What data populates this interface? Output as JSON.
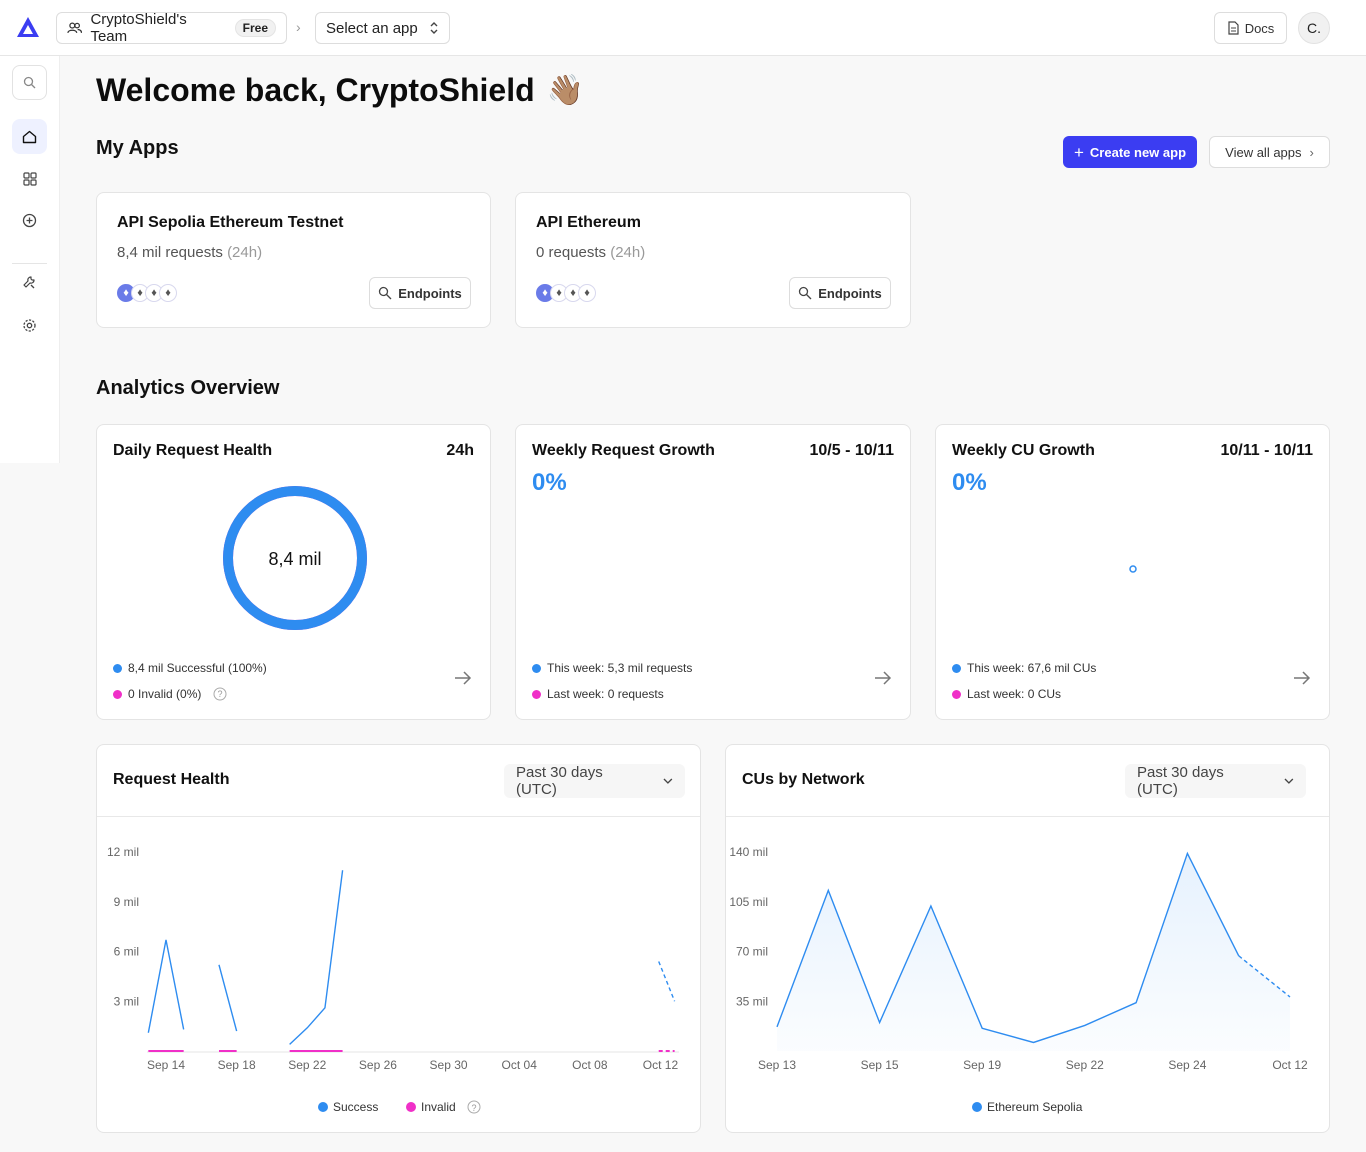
{
  "topbar": {
    "team_name": "CryptoShield's Team",
    "plan_badge": "Free",
    "app_select": "Select an app",
    "docs_label": "Docs",
    "avatar_initial": "C."
  },
  "sidebar": {
    "items": [
      "search-icon",
      "home-icon",
      "apps-grid-icon",
      "add-circle-icon",
      "tools-icon",
      "settings-icon"
    ],
    "active": "home-icon"
  },
  "welcome": {
    "title": "Welcome back, CryptoShield",
    "emoji": "👋🏽"
  },
  "my_apps": {
    "title": "My Apps",
    "create_label": "Create new app",
    "view_all_label": "View all apps",
    "apps": [
      {
        "name": "API Sepolia Ethereum Testnet",
        "requests": "8,4 mil requests",
        "window": "(24h)",
        "endpoints_label": "Endpoints"
      },
      {
        "name": "API Ethereum",
        "requests": "0 requests",
        "window": "(24h)",
        "endpoints_label": "Endpoints"
      }
    ]
  },
  "analytics": {
    "title": "Analytics Overview",
    "daily": {
      "title": "Daily Request Health",
      "period": "24h",
      "center_value": "8,4 mil",
      "success_fraction": 1.0,
      "success_label": "8,4 mil Successful (100%)",
      "invalid_label": "0 Invalid (0%)"
    },
    "weekly_requests": {
      "title": "Weekly Request Growth",
      "period": "10/5 - 10/11",
      "growth": "0%",
      "this_week": "This week: 5,3 mil requests",
      "last_week": "Last week: 0 requests"
    },
    "weekly_cu": {
      "title": "Weekly CU Growth",
      "period": "10/11 - 10/11",
      "growth": "0%",
      "this_week": "This week: 67,6 mil CUs",
      "last_week": "Last week: 0 CUs"
    }
  },
  "request_health": {
    "title": "Request Health",
    "period_select": "Past 30 days (UTC)",
    "legend_success": "Success",
    "legend_invalid": "Invalid"
  },
  "cus_by_network": {
    "title": "CUs by Network",
    "period_select": "Past 30 days (UTC)",
    "legend_series": "Ethereum Sepolia"
  },
  "colors": {
    "accent": "#3b3df2",
    "success": "#2e8cf0",
    "invalid": "#f030c8"
  },
  "chart_data": [
    {
      "type": "line",
      "title": "Request Health",
      "ylim": [
        0,
        12
      ],
      "y_ticks": [
        "3 mil",
        "6 mil",
        "9 mil",
        "12 mil"
      ],
      "y_tick_values": [
        3,
        6,
        9,
        12
      ],
      "x_ticks": [
        "Sep 14",
        "Sep 18",
        "Sep 22",
        "Sep 26",
        "Sep 30",
        "Oct 04",
        "Oct 08",
        "Oct 12"
      ],
      "x_tick_days": [
        0,
        4,
        8,
        12,
        16,
        20,
        24,
        28
      ],
      "series": [
        {
          "name": "Success",
          "color": "#2e8cf0",
          "segments": [
            [
              [
                -1,
                1.1
              ],
              [
                0,
                6.7
              ],
              [
                1,
                1.3
              ]
            ],
            [
              [
                3,
                5.2
              ],
              [
                4,
                1.2
              ]
            ],
            [
              [
                7,
                0.4
              ],
              [
                8,
                1.4
              ],
              [
                9,
                2.6
              ],
              [
                10,
                10.9
              ]
            ]
          ],
          "projected": [
            [
              27.9,
              5.4
            ],
            [
              28.8,
              3.0
            ]
          ]
        },
        {
          "name": "Invalid",
          "color": "#f030c8",
          "segments": [
            [
              [
                -1,
                0
              ],
              [
                1,
                0
              ]
            ],
            [
              [
                3,
                0
              ],
              [
                4,
                0
              ]
            ],
            [
              [
                7,
                0
              ],
              [
                10,
                0
              ]
            ]
          ],
          "projected": [
            [
              27.9,
              0
            ],
            [
              28.8,
              0
            ]
          ]
        }
      ],
      "grid": false,
      "legend": "bottom-center"
    },
    {
      "type": "area",
      "title": "CUs by Network",
      "ylim": [
        0,
        140
      ],
      "y_ticks": [
        "35 mil",
        "70 mil",
        "105 mil",
        "140 mil"
      ],
      "y_tick_values": [
        35,
        70,
        105,
        140
      ],
      "x_ticks": [
        "Sep 13",
        "Sep 15",
        "Sep 19",
        "Sep 22",
        "Sep 24",
        "Oct 12"
      ],
      "x_tick_positions": [
        0,
        2,
        4,
        6,
        8,
        10
      ],
      "series": [
        {
          "name": "Ethereum Sepolia",
          "color": "#2e8cf0",
          "points": [
            [
              0,
              17
            ],
            [
              1,
              113
            ],
            [
              2,
              20
            ],
            [
              3,
              102
            ],
            [
              4,
              16
            ],
            [
              5,
              6
            ],
            [
              6,
              18
            ],
            [
              7,
              34
            ],
            [
              8,
              139
            ],
            [
              9,
              67
            ]
          ],
          "projected": [
            [
              9,
              67
            ],
            [
              10,
              38
            ]
          ]
        }
      ],
      "grid": false,
      "legend": "bottom-center"
    }
  ]
}
